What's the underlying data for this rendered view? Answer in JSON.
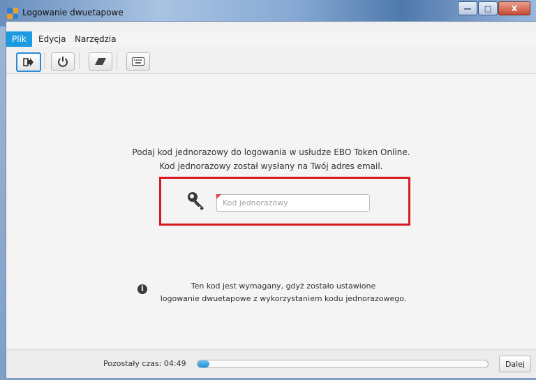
{
  "window": {
    "title": "Logowanie dwuetapowe",
    "controls": {
      "minimize": "—",
      "maximize": "□",
      "close": "X"
    }
  },
  "menu": {
    "items": [
      {
        "label": "Plik",
        "active": true
      },
      {
        "label": "Edycja",
        "active": false
      },
      {
        "label": "Narzędzia",
        "active": false
      }
    ]
  },
  "toolbar": {
    "buttons": [
      {
        "icon": "login-arrow-icon"
      },
      {
        "icon": "power-icon"
      },
      {
        "icon": "eraser-icon"
      },
      {
        "icon": "keyboard-icon"
      }
    ]
  },
  "prompt": {
    "line1": "Podaj kod jednorazowy do logowania w usłudze EBO Token Online.",
    "line2": "Kod jednorazowy został wysłany na Twój adres email."
  },
  "code_field": {
    "placeholder": "Kod jednorazowy",
    "value": "",
    "required": true
  },
  "info": {
    "line1": "Ten kod jest wymagany, gdyż zostało ustawione",
    "line2": "logowanie dwuetapowe z wykorzystaniem kodu jednorazowego."
  },
  "status": {
    "time_label": "Pozostały czas: 04:49",
    "progress_fraction": 0.04
  },
  "actions": {
    "next_label": "Dalej"
  },
  "colors": {
    "accent": "#1e9be0",
    "highlight": "#d71920",
    "required": "#e23b3b"
  }
}
